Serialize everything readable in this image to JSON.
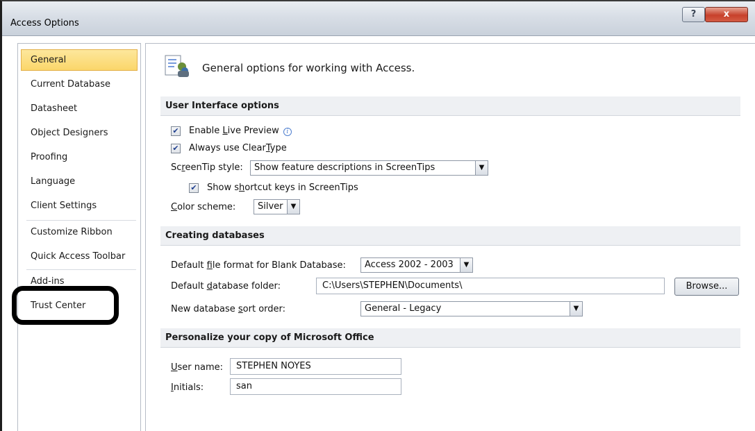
{
  "window": {
    "title": "Access Options"
  },
  "titlebar": {
    "help_glyph": "?",
    "close_glyph": "x"
  },
  "nav": {
    "items": [
      {
        "label": "General",
        "selected": true
      },
      {
        "label": "Current Database"
      },
      {
        "label": "Datasheet"
      },
      {
        "label": "Object Designers"
      },
      {
        "label": "Proofing"
      },
      {
        "label": "Language"
      },
      {
        "label": "Client Settings"
      },
      {
        "label": "Customize Ribbon"
      },
      {
        "label": "Quick Access Toolbar"
      },
      {
        "label": "Add-ins"
      },
      {
        "label": "Trust Center"
      }
    ]
  },
  "header": {
    "text": "General options for working with Access.",
    "icon": "general-options-icon"
  },
  "ui_options": {
    "section_title": "User Interface options",
    "enable_live_preview": {
      "label_pre": "Enable ",
      "label_u": "L",
      "label_post": "ive Preview",
      "checked": true
    },
    "always_cleartype": {
      "label_pre": "Always use Clear",
      "label_u": "T",
      "label_post": "ype",
      "checked": true
    },
    "screentip_label_pre": "Sc",
    "screentip_label_u": "r",
    "screentip_label_post": "eenTip style:",
    "screentip_value": "Show feature descriptions in ScreenTips",
    "show_shortcut": {
      "label_pre": "Show s",
      "label_u": "h",
      "label_post": "ortcut keys in ScreenTips",
      "checked": true
    },
    "color_label_u": "C",
    "color_label_post": "olor scheme:",
    "color_value": "Silver"
  },
  "creating_db": {
    "section_title": "Creating databases",
    "file_format_label_pre": "Default ",
    "file_format_label_u": "f",
    "file_format_label_post": "ile format for Blank Database:",
    "file_format_value": "Access 2002 - 2003",
    "folder_label_pre": "Default ",
    "folder_label_u": "d",
    "folder_label_post": "atabase folder:",
    "folder_value": "C:\\Users\\STEPHEN\\Documents\\",
    "browse_label": "Browse...",
    "sort_label_pre": "New database ",
    "sort_label_u": "s",
    "sort_label_post": "ort order:",
    "sort_value": "General - Legacy"
  },
  "personalize": {
    "section_title": "Personalize your copy of Microsoft Office",
    "username_label_u": "U",
    "username_label_post": "ser name:",
    "username_value": "STEPHEN NOYES",
    "initials_label_u": "I",
    "initials_label_post": "nitials:",
    "initials_value": "san"
  }
}
